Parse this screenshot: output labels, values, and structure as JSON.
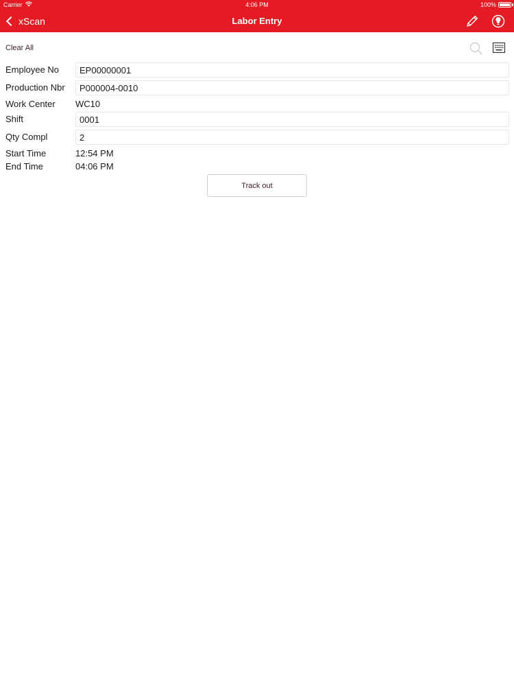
{
  "status_bar": {
    "carrier": "Carrier",
    "wifi_icon": "wifi-icon",
    "time": "4:06 PM",
    "battery": "100%"
  },
  "nav": {
    "back_label": "xScan",
    "title": "Labor Entry",
    "edit_icon": "pencil-icon",
    "idea_icon": "lightbulb-icon",
    "background_color": "#e41b24"
  },
  "toolbar": {
    "clear_all": "Clear All",
    "search_icon": "search-icon",
    "keyboard_icon": "keyboard-icon"
  },
  "form": {
    "employee_no": {
      "label": "Employee No",
      "value": "EP00000001"
    },
    "production_nbr": {
      "label": "Production Nbr",
      "value": "P000004-0010"
    },
    "work_center": {
      "label": "Work Center",
      "value": "WC10"
    },
    "shift": {
      "label": "Shift",
      "value": "0001"
    },
    "qty_compl": {
      "label": "Qty Compl",
      "value": "2"
    },
    "start_time": {
      "label": "Start Time",
      "value": "12:54 PM"
    },
    "end_time": {
      "label": "End Time",
      "value": "04:06 PM"
    }
  },
  "actions": {
    "track_out": "Track out"
  }
}
